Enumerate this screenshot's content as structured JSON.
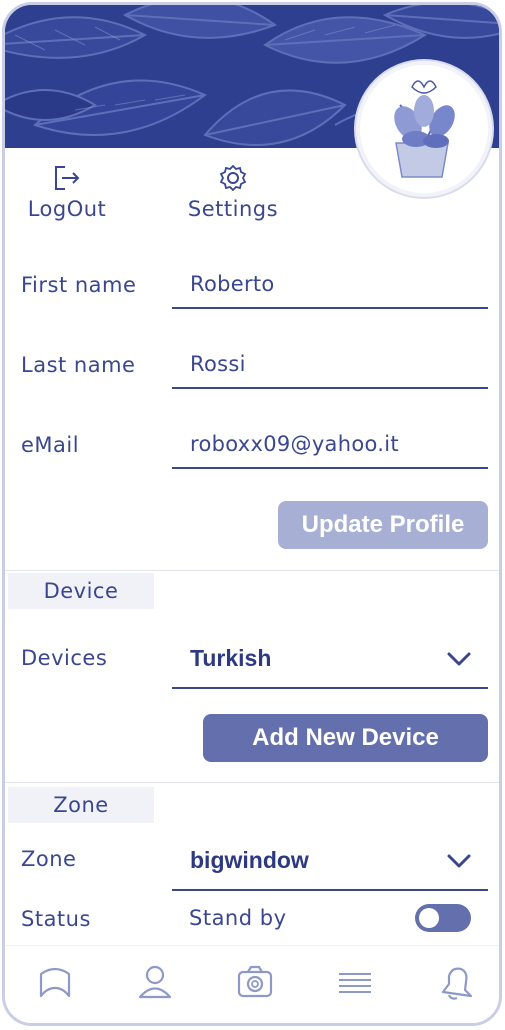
{
  "header": {
    "background_color": "#2f3f8f",
    "avatar_icon": "plant-avatar"
  },
  "actions": {
    "logout_label": "LogOut",
    "logout_icon": "logout-icon",
    "settings_label": "Settings",
    "settings_icon": "gear-icon"
  },
  "profile": {
    "first_name_label": "First name",
    "first_name_value": "Roberto",
    "last_name_label": "Last name",
    "last_name_value": "Rossi",
    "email_label": "eMail",
    "email_value": "roboxx09@yahoo.it",
    "update_button": "Update Profile"
  },
  "device": {
    "section_title": "Device",
    "devices_label": "Devices",
    "selected_device": "Turkish",
    "add_button": "Add New Device"
  },
  "zone": {
    "section_title": "Zone",
    "zone_label": "Zone",
    "selected_zone": "bigwindow",
    "status_label": "Status",
    "status_value": "Stand by",
    "status_toggle_on": false
  },
  "bottom_nav": {
    "items": [
      "home-icon",
      "profile-icon",
      "camera-icon",
      "menu-icon",
      "bell-icon"
    ]
  },
  "colors": {
    "primary": "#3a4790",
    "button_disabled": "#a7b0d4",
    "button_active": "#6470ad"
  }
}
